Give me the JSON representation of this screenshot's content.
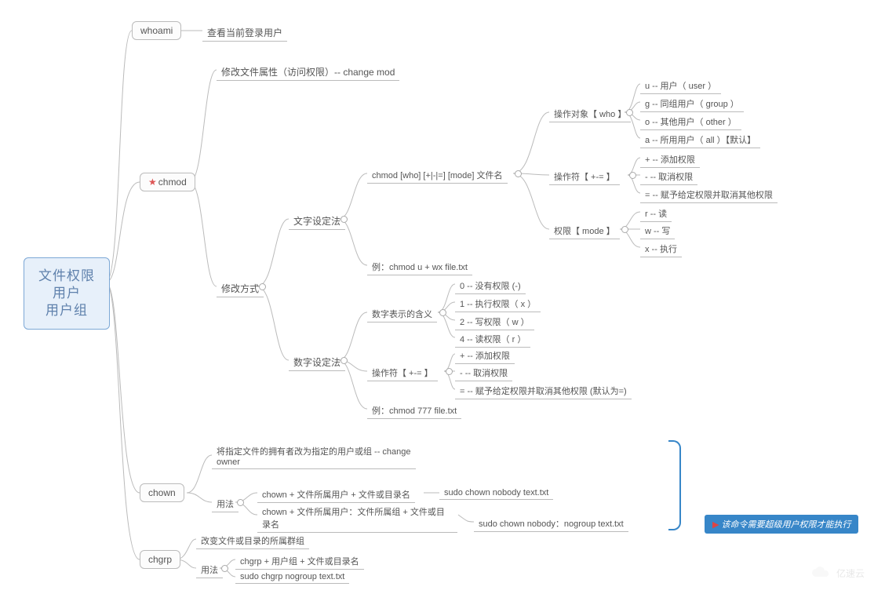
{
  "root": {
    "line1": "文件权限",
    "line2": "用户",
    "line3": "用户组"
  },
  "cmds": {
    "whoami": {
      "label": "whoami",
      "desc": "查看当前登录用户"
    },
    "chmod": {
      "label": "chmod",
      "desc": "修改文件属性（访问权限）-- change mod",
      "mod_way": "修改方式",
      "text_method": "文字设定法",
      "num_method": "数字设定法",
      "text_syntax": "chmod [who] [+|-|=] [mode] 文件名",
      "text_example": "例：chmod u + wx file.txt",
      "who": {
        "title": "操作对象【 who 】",
        "u": "u -- 用户（ user ）",
        "g": "g -- 同组用户（ group ）",
        "o": "o -- 其他用户（ other ）",
        "a": "a -- 所用用户（ all ）【默认】"
      },
      "op": {
        "title": "操作符【 +-= 】",
        "add": "+ -- 添加权限",
        "sub": "- -- 取消权限",
        "eq": "= -- 赋予给定权限并取消其他权限"
      },
      "mode": {
        "title": "权限【 mode 】",
        "r": "r -- 读",
        "w": "w -- 写",
        "x": "x -- 执行"
      },
      "num_meaning": {
        "title": "数字表示的含义",
        "p0": "0 -- 没有权限 (-)",
        "p1": "1 -- 执行权限（ x ）",
        "p2": "2 -- 写权限（ w ）",
        "p4": "4 -- 读权限（ r ）"
      },
      "num_op": {
        "title": "操作符【 +-= 】",
        "add": "+ -- 添加权限",
        "sub": "- -- 取消权限",
        "eq": "= -- 赋予给定权限并取消其他权限 (默认为=)"
      },
      "num_example": "例：chmod 777 file.txt"
    },
    "chown": {
      "label": "chown",
      "desc": "将指定文件的拥有者改为指定的用户或组 -- change owner",
      "usage": "用法",
      "u1": "chown + 文件所属用户 + 文件或目录名",
      "u1ex": "sudo chown nobody text.txt",
      "u2": "chown + 文件所属用户：文件所属组 + 文件或目录名",
      "u2ex": "sudo chown nobody：nogroup text.txt",
      "callout": "该命令需要超级用户权限才能执行"
    },
    "chgrp": {
      "label": "chgrp",
      "desc": "改变文件或目录的所属群组",
      "usage": "用法",
      "u1": "chgrp + 用户组 + 文件或目录名",
      "u2": "sudo chgrp nogroup text.txt"
    }
  },
  "watermark": "亿速云"
}
